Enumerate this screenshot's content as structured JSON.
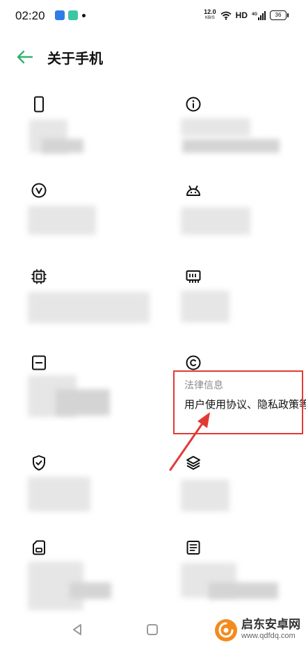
{
  "status_bar": {
    "time": "02:20",
    "net_speed_value": "12.0",
    "net_speed_unit": "KB/S",
    "hd": "HD",
    "signal_label": "4G",
    "battery": "36"
  },
  "header": {
    "title": "关于手机"
  },
  "items": {
    "legal": {
      "label": "法律信息",
      "value": "用户使用协议、隐私政策等"
    }
  },
  "icons": {
    "back": "back-arrow-icon",
    "device": "phone-icon",
    "info": "info-icon",
    "version": "version-icon",
    "android": "android-icon",
    "processor": "processor-chip-icon",
    "memory": "memory-icon",
    "storage": "storage-icon",
    "legal": "copyright-icon",
    "security": "shield-check-icon",
    "layers": "layers-icon",
    "sim": "sim-card-icon",
    "document": "document-icon"
  },
  "watermark": {
    "name": "启东安卓网",
    "url": "www.qdfdq.com"
  },
  "colors": {
    "accent": "#2db36f",
    "annotation": "#e23a36"
  }
}
